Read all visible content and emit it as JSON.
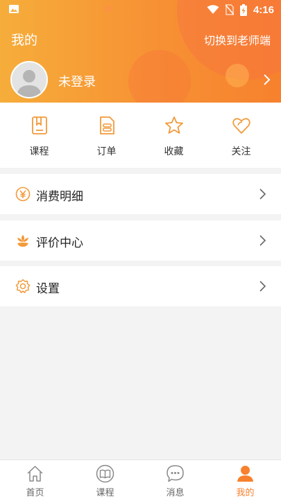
{
  "status_bar": {
    "time": "4:16"
  },
  "header": {
    "title": "我的",
    "switch_label": "切换到老师端",
    "login_text": "未登录"
  },
  "quick_actions": [
    {
      "label": "课程",
      "icon": "bookmark-icon"
    },
    {
      "label": "订单",
      "icon": "order-icon"
    },
    {
      "label": "收藏",
      "icon": "star-icon"
    },
    {
      "label": "关注",
      "icon": "heart-icon"
    }
  ],
  "menu": [
    {
      "label": "消费明细",
      "icon": "yuan-icon"
    },
    {
      "label": "评价中心",
      "icon": "lotus-icon"
    },
    {
      "label": "设置",
      "icon": "gear-icon"
    }
  ],
  "tabs": [
    {
      "label": "首页",
      "icon": "home-icon"
    },
    {
      "label": "课程",
      "icon": "book-icon"
    },
    {
      "label": "消息",
      "icon": "message-icon"
    },
    {
      "label": "我的",
      "icon": "person-icon",
      "active": true
    }
  ],
  "colors": {
    "accent": "#f7812e",
    "header_start": "#f6ad3a",
    "icon_orange": "#f29a3a"
  }
}
